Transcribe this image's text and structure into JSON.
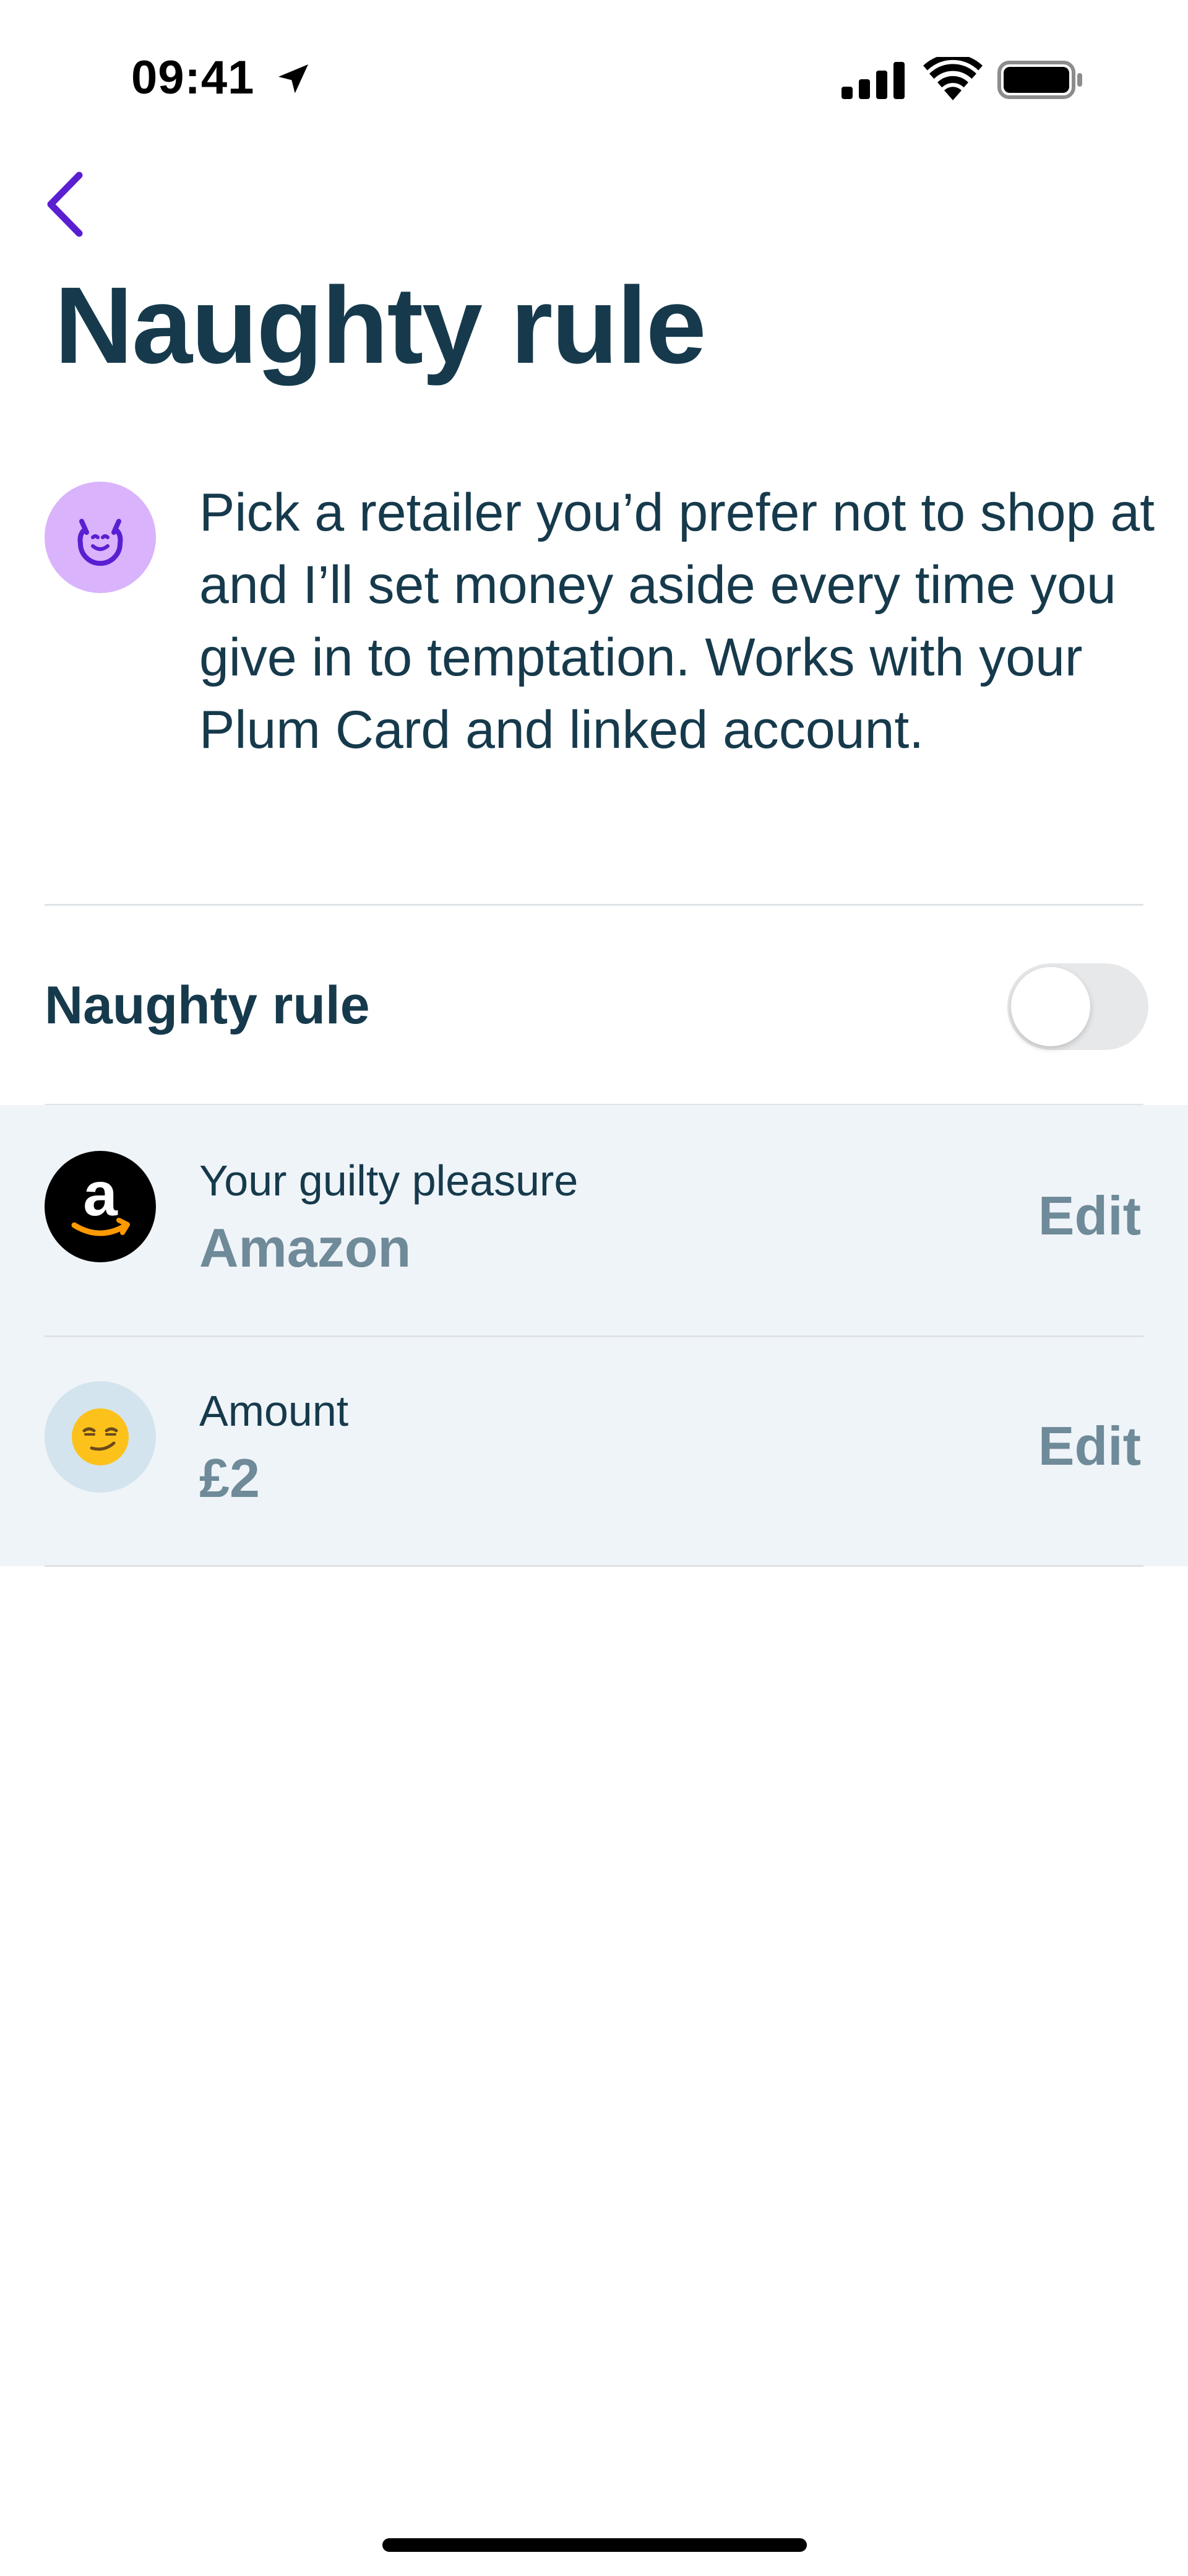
{
  "status_bar": {
    "time": "09:41"
  },
  "page": {
    "title": "Naughty rule",
    "intro": "Pick a retailer you’d prefer not to shop at and I’ll set money aside every time you give in to temptation. Works with your Plum Card and linked account."
  },
  "toggle": {
    "label": "Naughty rule",
    "enabled": false
  },
  "settings": [
    {
      "label": "Your guilty pleasure",
      "value": "Amazon",
      "action": "Edit",
      "icon": "amazon-logo-icon",
      "logo_letter": "a"
    },
    {
      "label": "Amount",
      "value": "£2",
      "action": "Edit",
      "icon": "smirking-face-icon"
    }
  ],
  "colors": {
    "primary_text": "#163a4c",
    "accent_purple": "#5a1fd1",
    "intro_icon_bg": "#d9b3fb",
    "muted_value": "#6f8a99",
    "panel_bg": "#eff4f8",
    "amount_icon_bg": "#d4e4ee"
  }
}
